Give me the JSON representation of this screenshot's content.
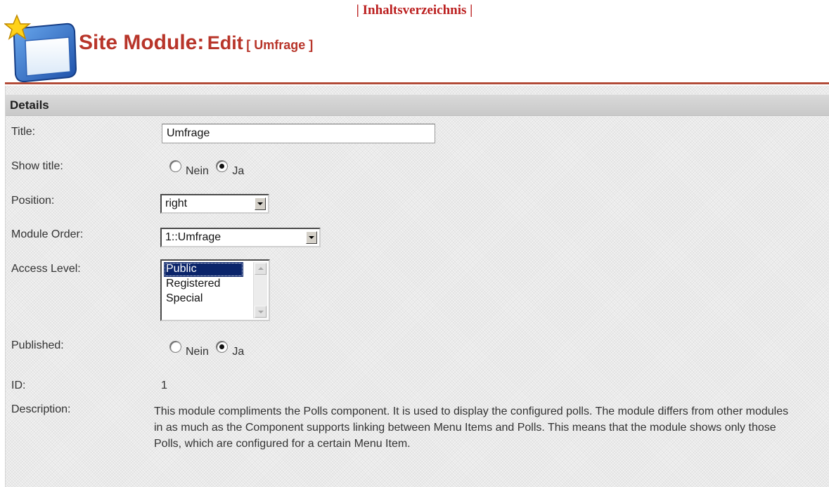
{
  "top_link": {
    "prefix": "| ",
    "title": "Inhaltsverzeichnis",
    "suffix": " |"
  },
  "header": {
    "title": "Site Module:",
    "action": "Edit",
    "subject": "[ Umfrage ]"
  },
  "section": {
    "title": "Details"
  },
  "fields": {
    "title": {
      "label": "Title:",
      "value": "Umfrage"
    },
    "show_title": {
      "label": "Show title:",
      "options": [
        "Nein",
        "Ja"
      ],
      "selected": "Ja"
    },
    "position": {
      "label": "Position:",
      "value": "right"
    },
    "module_order": {
      "label": "Module Order:",
      "value": "1::Umfrage"
    },
    "access_level": {
      "label": "Access Level:",
      "options": [
        "Public",
        "Registered",
        "Special"
      ],
      "selected": "Public"
    },
    "published": {
      "label": "Published:",
      "options": [
        "Nein",
        "Ja"
      ],
      "selected": "Ja"
    },
    "id": {
      "label": "ID:",
      "value": "1"
    },
    "description": {
      "label": "Description:",
      "value": "This module compliments the Polls component. It is used to display the configured polls. The module differs from other modules in as much as the Component supports linking between Menu Items and Polls. This means that the module shows only those Polls, which are configured for a certain Menu Item."
    }
  },
  "colors": {
    "heading": "#b8352a",
    "link": "#bb1f1f",
    "selected_option": "#0a246a"
  },
  "icons": {
    "header": "module-window-star-icon"
  }
}
